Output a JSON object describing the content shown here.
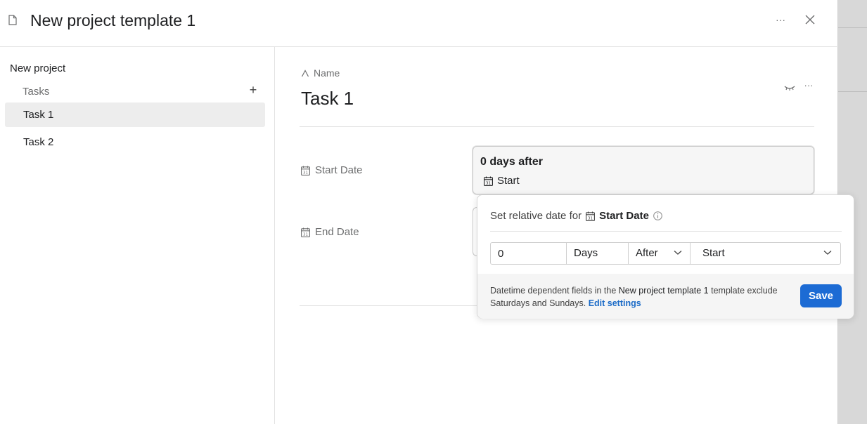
{
  "header": {
    "title": "New project template 1",
    "more_label": "···"
  },
  "sidebar": {
    "project": "New project",
    "section": "Tasks",
    "add_label": "+",
    "items": [
      {
        "label": "Task 1",
        "active": true
      },
      {
        "label": "Task 2",
        "active": false
      }
    ]
  },
  "main": {
    "name_label": "Name",
    "task_title": "Task 1",
    "more_label": "···",
    "start_date": {
      "label": "Start Date",
      "value": "0 days after",
      "reference": "Start"
    },
    "end_date": {
      "label": "End Date"
    }
  },
  "popover": {
    "title_prefix": "Set relative date for",
    "title_field": "Start Date",
    "offset_value": "0",
    "unit": "Days",
    "direction": "After",
    "reference": "Start",
    "note_part1": "Datetime dependent fields in the",
    "note_template": "New project template 1",
    "note_part2": "template exclude Saturdays and Sundays.",
    "note_link": "Edit settings",
    "save_label": "Save"
  },
  "colors": {
    "accent": "#1c6bd4",
    "link": "#1b6bc7",
    "active_item": "#ededed"
  }
}
